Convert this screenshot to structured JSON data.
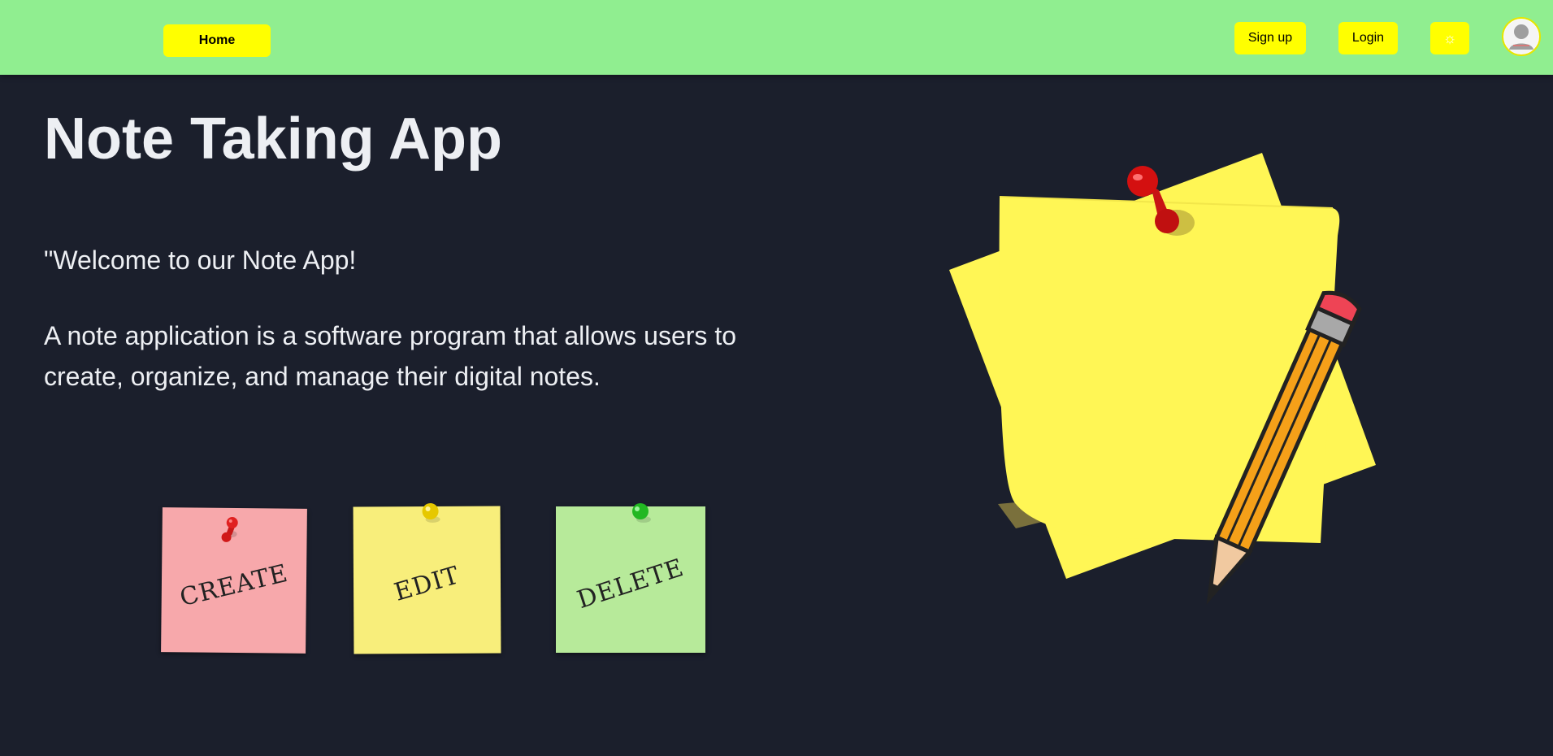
{
  "navbar": {
    "background": "#90ee90",
    "accent": "#ffff00",
    "home_label": "Home",
    "signup_label": "Sign up",
    "login_label": "Login",
    "theme_icon": "sun-icon",
    "theme_glyph": "☼",
    "avatar_icon": "user-avatar-icon"
  },
  "hero": {
    "title": "Note Taking App",
    "welcome": "\"Welcome to our Note App!",
    "description": "A note application is a software program that allows users to create, organize, and manage their digital notes."
  },
  "notes": [
    {
      "label": "CREATE",
      "color": "#f7a8ab",
      "pin_color": "#e02020"
    },
    {
      "label": "EDIT",
      "color": "#f8ee7b",
      "pin_color": "#e6c800"
    },
    {
      "label": "DELETE",
      "color": "#b7ea9a",
      "pin_color": "#22b822"
    }
  ],
  "illustration": {
    "icon": "sticky-notes-with-pencil-illustration",
    "note_color": "#fff655",
    "pin_color": "#d41010",
    "pencil_color": "#f5a019"
  },
  "colors": {
    "page_background": "#1b1f2c",
    "text": "#edeff3"
  }
}
